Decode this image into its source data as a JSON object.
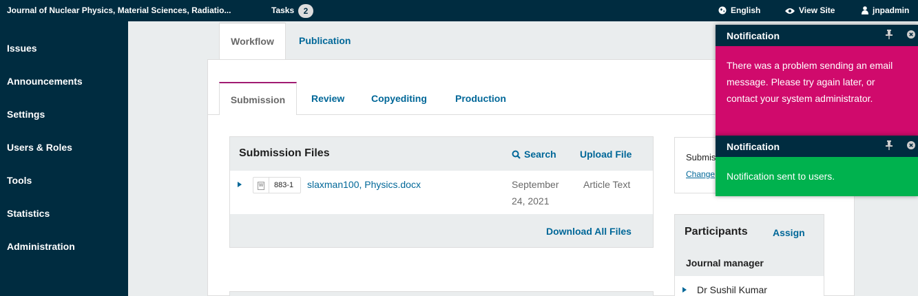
{
  "topbar": {
    "journal_title": "Journal of Nuclear Physics, Material Sciences, Radiatio...",
    "tasks_label": "Tasks",
    "tasks_count": "2",
    "language": "English",
    "view_site": "View Site",
    "user": "jnpadmin"
  },
  "sidebar": {
    "items": [
      {
        "label": "Issues"
      },
      {
        "label": "Announcements"
      },
      {
        "label": "Settings"
      },
      {
        "label": "Users & Roles"
      },
      {
        "label": "Tools"
      },
      {
        "label": "Statistics"
      },
      {
        "label": "Administration"
      }
    ]
  },
  "page_tabs": {
    "workflow": "Workflow",
    "publication": "Publication"
  },
  "stage_tabs": {
    "submission": "Submission",
    "review": "Review",
    "copyediting": "Copyediting",
    "production": "Production"
  },
  "submission_files": {
    "title": "Submission Files",
    "search_label": "Search",
    "upload_label": "Upload File",
    "rows": [
      {
        "id": "883-1",
        "name": "slaxman100, Physics.docx",
        "date": "September 24, 2021",
        "type": "Article Text"
      }
    ],
    "download_all": "Download All Files"
  },
  "status_box": {
    "status_text": "Submission",
    "change_link": "Change"
  },
  "participants": {
    "title": "Participants",
    "assign": "Assign",
    "role": "Journal manager",
    "people": [
      "Dr Sushil Kumar"
    ]
  },
  "notifications": [
    {
      "title": "Notification",
      "message": "There was a problem sending an email message. Please try again later, or contact your system administrator.",
      "color": "#d00a6c"
    },
    {
      "title": "Notification",
      "message": "Notification sent to users.",
      "color": "#00b24e"
    }
  ],
  "colors": {
    "header_bg": "#002c40",
    "link": "#006798",
    "active_tab_border": "#a01a71"
  }
}
